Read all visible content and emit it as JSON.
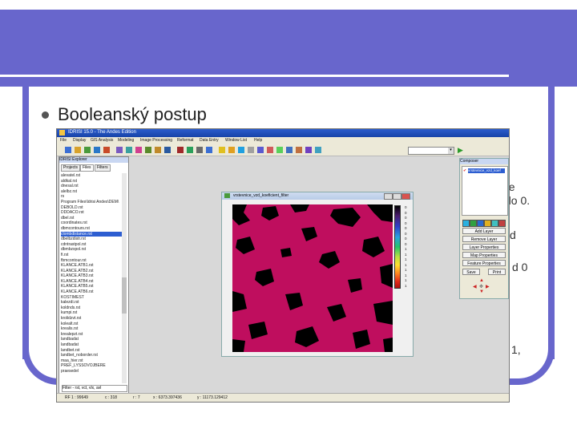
{
  "slide": {
    "bullet": "Booleanský postup",
    "bg_lines": [
      "kde",
      "do 0.",
      "d",
      "d 0",
      "1,"
    ]
  },
  "app": {
    "title": "IDRISI 15.0 - The Andes Edition",
    "menu": [
      "File",
      "Display",
      "GIS Analysis",
      "Modeling",
      "Image Processing",
      "Reformat",
      "Data Entry",
      "Window List",
      "Help"
    ]
  },
  "explorer": {
    "title": "IDRISI Explorer",
    "tabs": [
      "Projects",
      "Files",
      "Filters"
    ],
    "files": [
      "alevatel.rst",
      "aldkal.rst",
      "dnesal.rst",
      "alelbz.rst",
      "rs",
      "Program Files\\Idrisi Andes\\DEM\\",
      "DEBOLD.rst",
      "DDDACO.rst",
      "dbel.rst",
      "coordinates.rst",
      "dbmcontours.rst",
      "clombdistance.rst",
      "dbelbzdistr.rst",
      "cdntrastpol.rst",
      "dbmbzxpol.rst",
      "fi.rst",
      "fbmcontour.rst",
      "KLANCE.ATB1.rst",
      "KLANCE.ATB2.rst",
      "KLANCE.ATB3.rst",
      "KLANCE.ATB4.rst",
      "KLANCE.ATB5.rst",
      "KLANCE.ATB6.rst",
      "KOSTIMEST",
      "kalezdi.rst",
      "koldnds.rst",
      "kumpi.rst",
      "krolidzvt.rst",
      "kolealt.rst",
      "krealis.rst",
      "krealepzt.rst",
      "landbadat",
      "landbadat",
      "landbet.rst",
      "landbet_noborder.rst",
      "maa_hier.rst",
      "PREF_LYSSOVOJBERE",
      "praesedel"
    ],
    "filter_value": "Filter - rst, vct, vlx, avl"
  },
  "map": {
    "title": "vrstevnice_vzd_koeficient_filter",
    "legend_ticks": [
      "0",
      "0",
      "0",
      "0",
      "0",
      "0",
      "0",
      "0",
      "1",
      "1",
      "1",
      "1",
      "1",
      "1",
      "1",
      "1"
    ]
  },
  "composer": {
    "title": "Composer",
    "layer": "vrstevnice_vzd_koef",
    "buttons": [
      "Add Layer",
      "Remove Layer",
      "Layer Properties",
      "Map Properties",
      "Feature Properties"
    ],
    "small_buttons": [
      "Save",
      "Print"
    ]
  },
  "status": {
    "cells": [
      "RF 1 : 99649",
      "c : 318",
      "r : 7",
      "x : 6373.397436",
      "y : 11173.129412"
    ]
  }
}
